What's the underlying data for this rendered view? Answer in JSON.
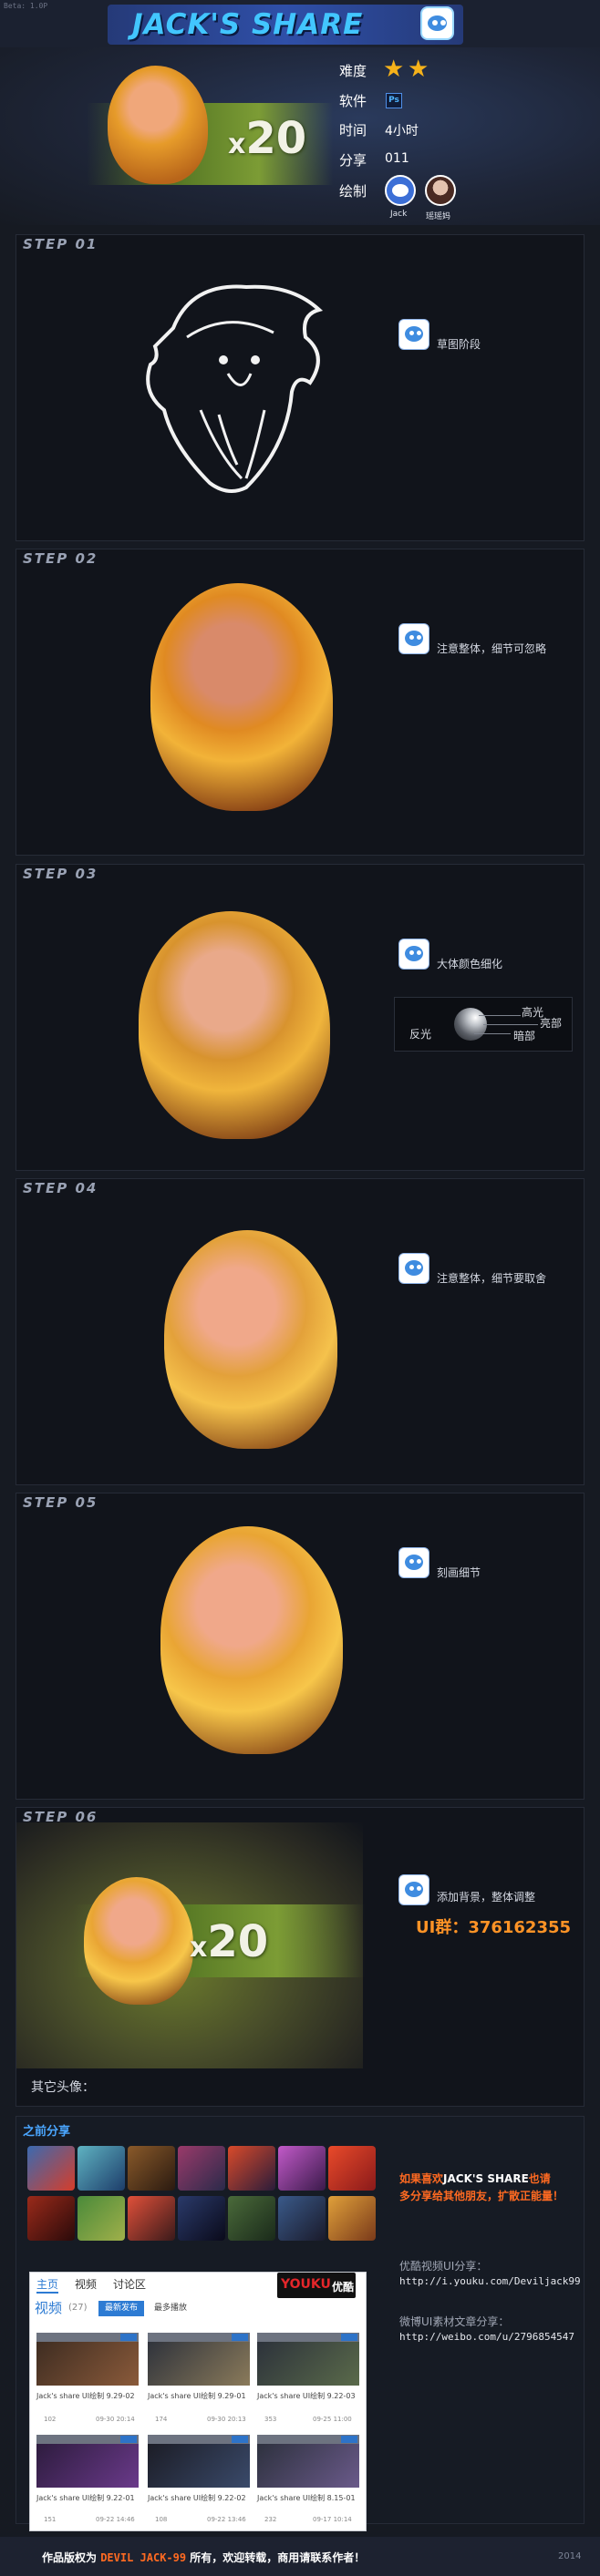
{
  "header": {
    "credit": "Beta: 1.0P",
    "title": "JACK'S SHARE"
  },
  "hero": {
    "count_x": "x",
    "count_n": "20",
    "meta": [
      {
        "label": "难度",
        "value": ""
      },
      {
        "label": "软件",
        "value": "Ps"
      },
      {
        "label": "时间",
        "value": "4小时"
      },
      {
        "label": "分享",
        "value": "011"
      },
      {
        "label": "绘制",
        "value": ""
      }
    ],
    "difficulty_stars": 2,
    "authors": [
      {
        "name": "Jack"
      },
      {
        "name": "瑶瑶妈"
      }
    ]
  },
  "steps": [
    {
      "label": "STEP  01",
      "note": "草图阶段"
    },
    {
      "label": "STEP  02",
      "note": "注意整体，细节可忽略"
    },
    {
      "label": "STEP  03",
      "note": "大体颜色细化"
    },
    {
      "label": "STEP  04",
      "note": "注意整体，细节要取舍"
    },
    {
      "label": "STEP  05",
      "note": "刻画细节"
    },
    {
      "label": "STEP  06",
      "note": "添加背景，整体调整"
    }
  ],
  "lighting": {
    "highlight": "高光",
    "light": "亮部",
    "dark": "暗部",
    "reflect": "反光"
  },
  "ui_group": "UI群：376162355",
  "other_avatars": "其它头像：",
  "previous": {
    "title": "之前分享",
    "promo_line1_a": "如果喜欢",
    "promo_line1_b": "JACK'S SHARE",
    "promo_line1_c": "也请",
    "promo_line2": "多分享给其他朋友，扩散正能量！",
    "youku_label": "优酷视频UI分享：",
    "youku_url": "http://i.youku.com/Deviljack99",
    "weibo_label": "微博UI素材文章分享：",
    "weibo_url": "http://weibo.com/u/2796854547"
  },
  "youku": {
    "tabs": [
      "主页",
      "视频",
      "讨论区"
    ],
    "logo_a": "YOUKU",
    "logo_b": "优酷",
    "videos_label": "视频",
    "videos_count": "(27)",
    "btn_latest": "最新发布",
    "btn_most": "最多播放",
    "videos": [
      {
        "title": "Jack's share UI绘制 9.29-02",
        "plays": "102",
        "date": "09-30 20:14"
      },
      {
        "title": "Jack's share UI绘制 9.29-01",
        "plays": "174",
        "date": "09-30 20:13"
      },
      {
        "title": "Jack's share UI绘制 9.22-03",
        "plays": "353",
        "date": "09-25 11:00"
      },
      {
        "title": "Jack's share UI绘制 9.22-01",
        "plays": "151",
        "date": "09-22 14:46"
      },
      {
        "title": "Jack's share UI绘制 9.22-02",
        "plays": "108",
        "date": "09-22 13:46"
      },
      {
        "title": "Jack's share UI绘制 8.15-01",
        "plays": "232",
        "date": "09-17 10:14"
      }
    ]
  },
  "footer": {
    "a": "作品版权为 ",
    "b": "DEVIL JACK-99",
    "c": " 所有，欢迎转载，商用请联系作者！",
    "year": "2014"
  },
  "colors": {
    "accent_blue": "#42c6ff",
    "orange": "#ff6a21",
    "star": "#f6b21a",
    "panel": "#11141b"
  }
}
